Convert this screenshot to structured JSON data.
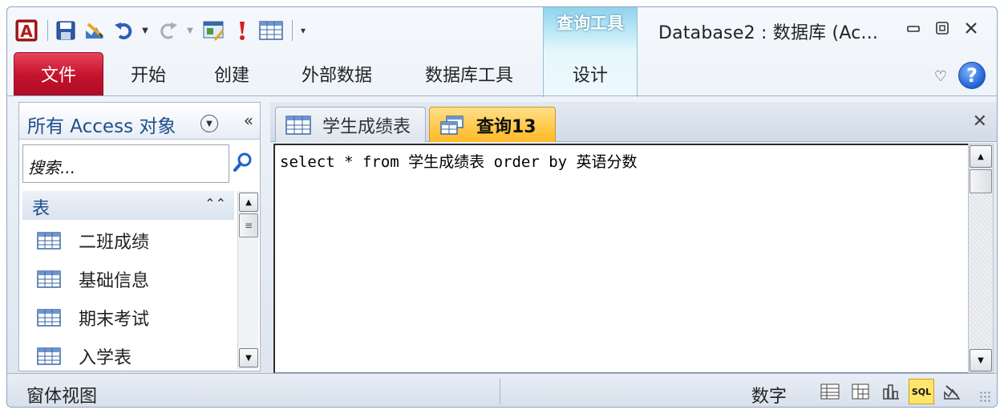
{
  "title_bar": {
    "window_title": "Database2 : 数据库 (Ac...",
    "contextual_group": "查询工具",
    "quick_access": [
      "access-logo-icon",
      "save-icon",
      "view-design-icon",
      "undo-icon",
      "redo-icon",
      "switchboard-icon",
      "run-icon",
      "table-icon",
      "customize-icon"
    ]
  },
  "ribbon": {
    "file_tab": "文件",
    "tabs": [
      "开始",
      "创建",
      "外部数据",
      "数据库工具"
    ],
    "design_tab": "设计"
  },
  "nav_pane": {
    "title": "所有 Access 对象",
    "search_placeholder": "搜索...",
    "group_label": "表",
    "items": [
      "二班成绩",
      "基础信息",
      "期末考试",
      "入学表"
    ]
  },
  "doc_tabs": [
    {
      "label": "学生成绩表",
      "icon": "table-icon",
      "active": false
    },
    {
      "label": "查询13",
      "icon": "query-icon",
      "active": true
    }
  ],
  "sql_editor": {
    "content": "select * from 学生成绩表 order by 英语分数"
  },
  "status_bar": {
    "view_label": "窗体视图",
    "num_lock": "数字",
    "sql_view_label": "SQL"
  },
  "colors": {
    "file_tab": "#c4122d",
    "active_doc_tab": "#ffc848",
    "contextual_tab": "#8fd3ec",
    "accent_text": "#1f4e8a"
  }
}
